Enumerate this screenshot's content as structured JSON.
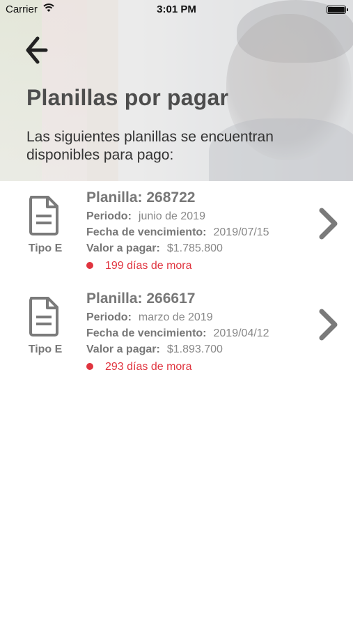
{
  "status_bar": {
    "carrier": "Carrier",
    "time": "3:01 PM"
  },
  "header": {
    "title": "Planillas por pagar",
    "subtitle": "Las siguientes planillas se encuentran disponibles para pago:"
  },
  "planillas": [
    {
      "tipo": "Tipo E",
      "title": "Planilla: 268722",
      "periodo_label": "Periodo:",
      "periodo": "junio de 2019",
      "vencimiento_label": "Fecha de vencimiento:",
      "vencimiento": "2019/07/15",
      "valor_label": "Valor a pagar:",
      "valor": "$1.785.800",
      "mora": "199 días de mora"
    },
    {
      "tipo": "Tipo E",
      "title": "Planilla: 266617",
      "periodo_label": "Periodo:",
      "periodo": "marzo de 2019",
      "vencimiento_label": "Fecha de vencimiento:",
      "vencimiento": "2019/04/12",
      "valor_label": "Valor a pagar:",
      "valor": "$1.893.700",
      "mora": "293 días de mora"
    }
  ],
  "icons": {
    "back": "arrow-left-icon",
    "document": "document-icon",
    "chevron": "chevron-right-icon",
    "wifi": "wifi-icon",
    "battery": "battery-icon"
  },
  "colors": {
    "mora": "#e0343f",
    "text": "#777777",
    "title": "#4d4d4d"
  }
}
